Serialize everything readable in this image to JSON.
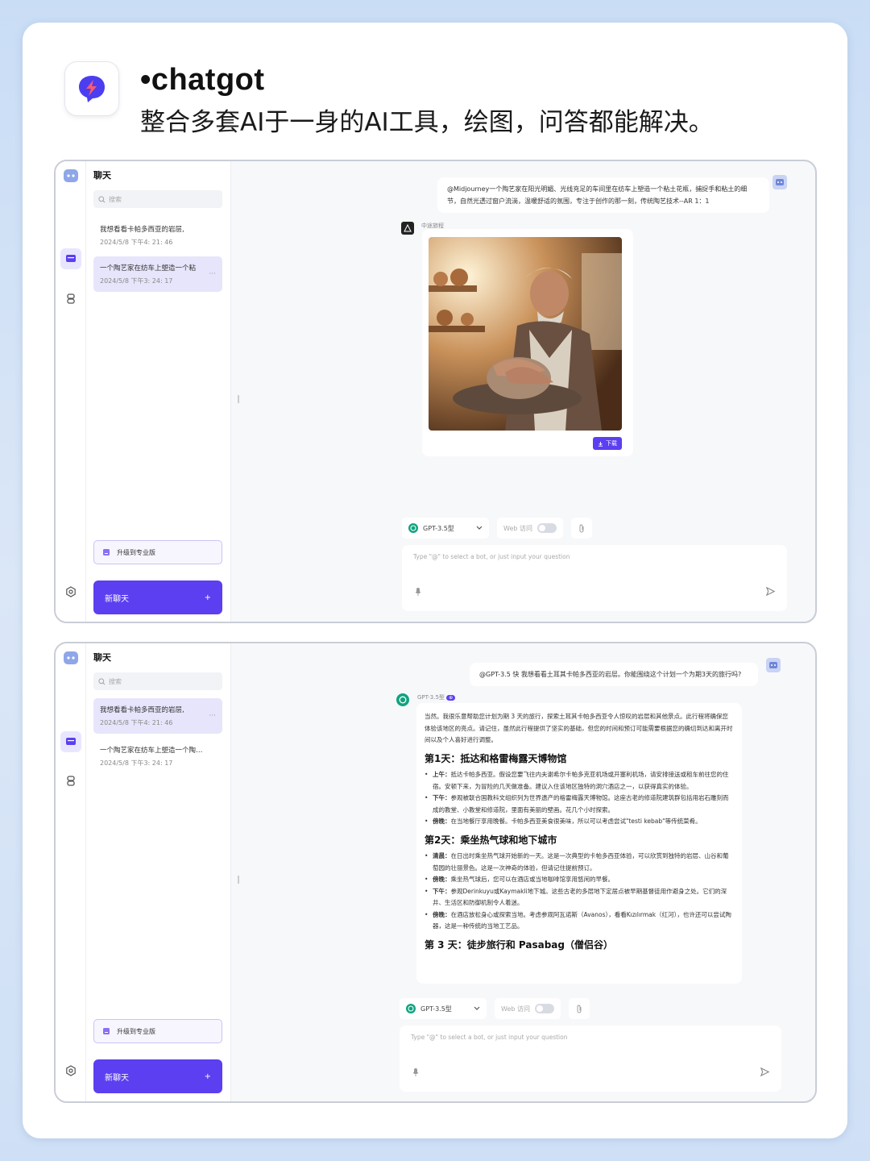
{
  "header": {
    "app_name": "•chatgot",
    "tagline": "整合多套AI于一身的AI工具，绘图，问答都能解决。"
  },
  "screen1": {
    "sidebar": {
      "title": "聊天",
      "search_placeholder": "搜索",
      "chats": [
        {
          "title": "我想看看卡帕多西亚的岩层,",
          "date": "2024/5/8 下午4: 21: 46"
        },
        {
          "title": "一个陶艺家在纺车上塑造一个粘",
          "date": "2024/5/8 下午3: 24: 17"
        }
      ],
      "upgrade_label": "升级到专业版",
      "new_chat_label": "新聊天",
      "new_chat_plus": "+"
    },
    "user_message": "@Midjourney一个陶艺家在阳光明媚、光线充足的车间里在纺车上塑造一个粘土花瓶，捕捉手和粘土的细节，自然光透过窗户流淌，温暖舒适的氛围，专注于创作的那一刻，传统陶艺技术--AR 1：1",
    "bot_name": "中途旅程",
    "download_label": "下载",
    "model_label": "GPT-3.5型",
    "web_label": "Web 访问",
    "input_placeholder": "Type \"@\" to select a bot, or just input your question"
  },
  "screen2": {
    "sidebar": {
      "title": "聊天",
      "search_placeholder": "搜索",
      "chats": [
        {
          "title": "我想看看卡帕多西亚的岩层,",
          "date": "2024/5/8 下午4: 21: 46"
        },
        {
          "title": "一个陶艺家在纺车上塑造一个陶花...",
          "date": "2024/5/8 下午3: 24: 17"
        }
      ],
      "upgrade_label": "升级到专业版",
      "new_chat_label": "新聊天",
      "new_chat_plus": "+"
    },
    "user_message": "@GPT-3.5 快 我想看看土耳其卡帕多西亚的岩层。你能围绕这个计划一个为期3天的旅行吗?",
    "bot_name": "GPT-3.5型",
    "bot_badge": "⊕",
    "answer": {
      "intro": "当然。我很乐意帮助您计划为期 3 天的旅行，探索土耳其卡帕多西亚令人惊叹的岩层和其他景点。此行程将确保您体验该地区的亮点。请记住，虽然此行程提供了坚实的基础，但您的时间和预订可能需要根据您的确切到达和离开时间以及个人喜好进行调整。",
      "day1_title": "第1天：抵达和格雷梅露天博物馆",
      "day1_items": [
        {
          "k": "上午：",
          "v": "抵达卡帕多西亚。假设您要飞往内夫谢希尔卡帕多克亚机场或开塞利机场，请安排接送或租车前往您的住宿。安顿下来，为冒险的几天做准备。建议入住该地区独特的洞穴酒店之一，以获得真实的体验。"
        },
        {
          "k": "下午：",
          "v": "参观被联合国教科文组织列为世界遗产的格雷梅露天博物馆。这座古老的修道院建筑群包括用岩石雕刻而成的教堂、小教堂和修道院，里面有美丽的壁画。花几个小时探索。"
        },
        {
          "k": "傍晚：",
          "v": "在当地餐厅享用晚餐。卡帕多西亚美食很美味，所以可以考虑尝试\"testi kebab\"等传统菜肴。"
        }
      ],
      "day2_title": "第2天：乘坐热气球和地下城市",
      "day2_items": [
        {
          "k": "清晨：",
          "v": "在日出时乘坐热气球开始新的一天。这是一次典型的卡帕多西亚体验，可以欣赏到独特的岩层、山谷和葡萄园的壮丽景色。这是一次神奇的体验，但请记住提前预订。"
        },
        {
          "k": "傍晚：",
          "v": "乘坐热气球后，您可以在酒店或当地咖啡馆享用悠闲的早餐。"
        },
        {
          "k": "下午：",
          "v": "参观Derinkuyu或Kaymakli地下城。这些古老的多层地下定居点被早期基督徒用作避身之处。它们的深井、生活区和防御机制令人着迷。"
        },
        {
          "k": "傍晚：",
          "v": "在酒店放松身心或探索当地。考虑参观阿瓦诺斯（Avanos），看看Kızılırmak（红河），也许还可以尝试陶器，这是一种传统的当地工艺品。"
        }
      ],
      "day3_title": "第 3 天：徒步旅行和 Pasabag（僧侣谷）"
    },
    "model_label": "GPT-3.5型",
    "web_label": "Web 访问",
    "input_placeholder": "Type \"@\" to select a bot, or just input your question"
  },
  "colors": {
    "accent": "#5b3ff0",
    "active_chat": "#e7e5fb",
    "logo": "#4b3ef0"
  }
}
